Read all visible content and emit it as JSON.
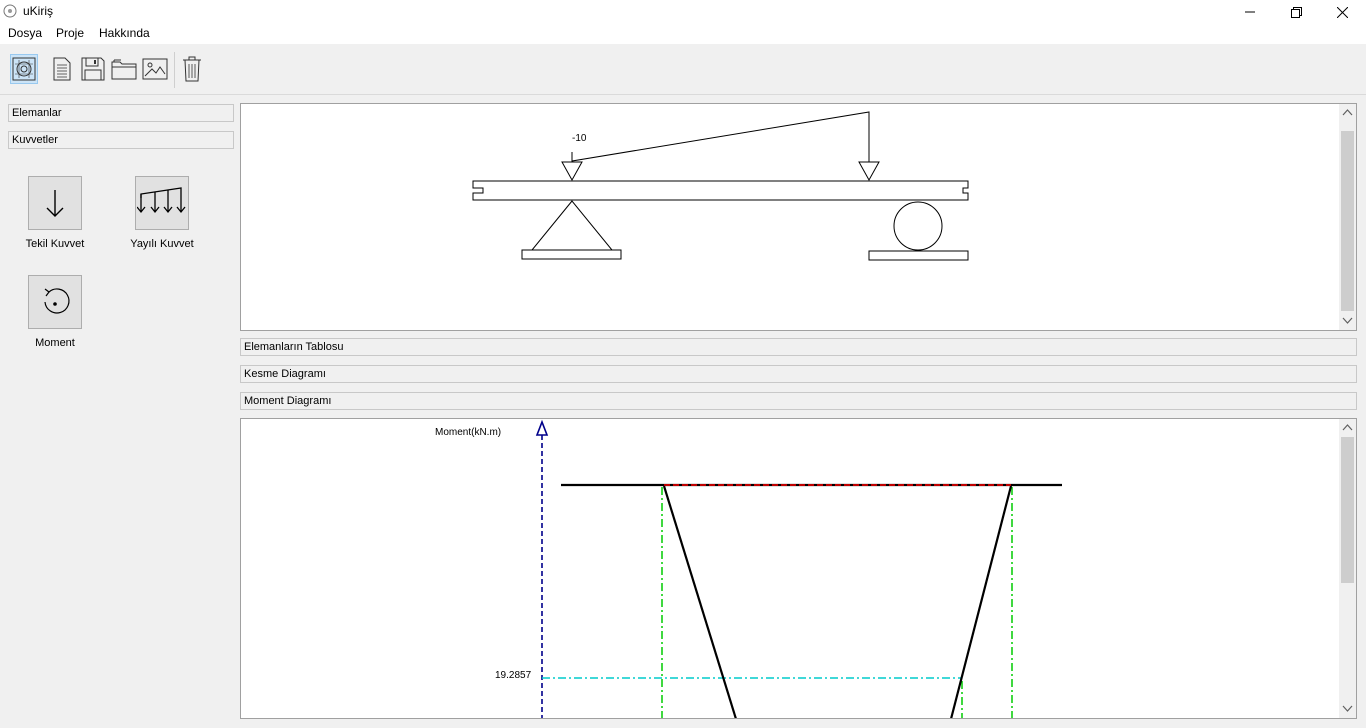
{
  "window": {
    "title": "uKiriş",
    "controls": [
      "minimize",
      "maximize",
      "close"
    ]
  },
  "menu": {
    "items": [
      "Dosya",
      "Proje",
      "Hakkında"
    ]
  },
  "toolbar": {
    "icons": [
      "beam-design-icon",
      "new-document-icon",
      "save-icon",
      "open-folder-icon",
      "image-export-icon",
      "trash-icon"
    ]
  },
  "left_panel": {
    "sections": [
      "Elemanlar",
      "Kuvvetler"
    ],
    "tools": [
      {
        "label": "Tekil Kuvvet",
        "icon": "arrow-down-icon"
      },
      {
        "label": "Yayılı Kuvvet",
        "icon": "distributed-load-icon"
      },
      {
        "label": "Moment",
        "icon": "moment-icon"
      }
    ]
  },
  "beam_view": {
    "load_label": "-10"
  },
  "sections": {
    "table": "Elemanların Tablosu",
    "shear": "Kesme Diagramı",
    "moment": "Moment Diagramı"
  },
  "moment_diagram": {
    "axis_label": "Moment(kN.m)",
    "value_label": "19.2857",
    "colors": {
      "axis": "#00008b",
      "reference_line": "#ff0000",
      "support_lines": "#00cc00",
      "value_line": "#00cccc",
      "curve": "#000000"
    }
  }
}
